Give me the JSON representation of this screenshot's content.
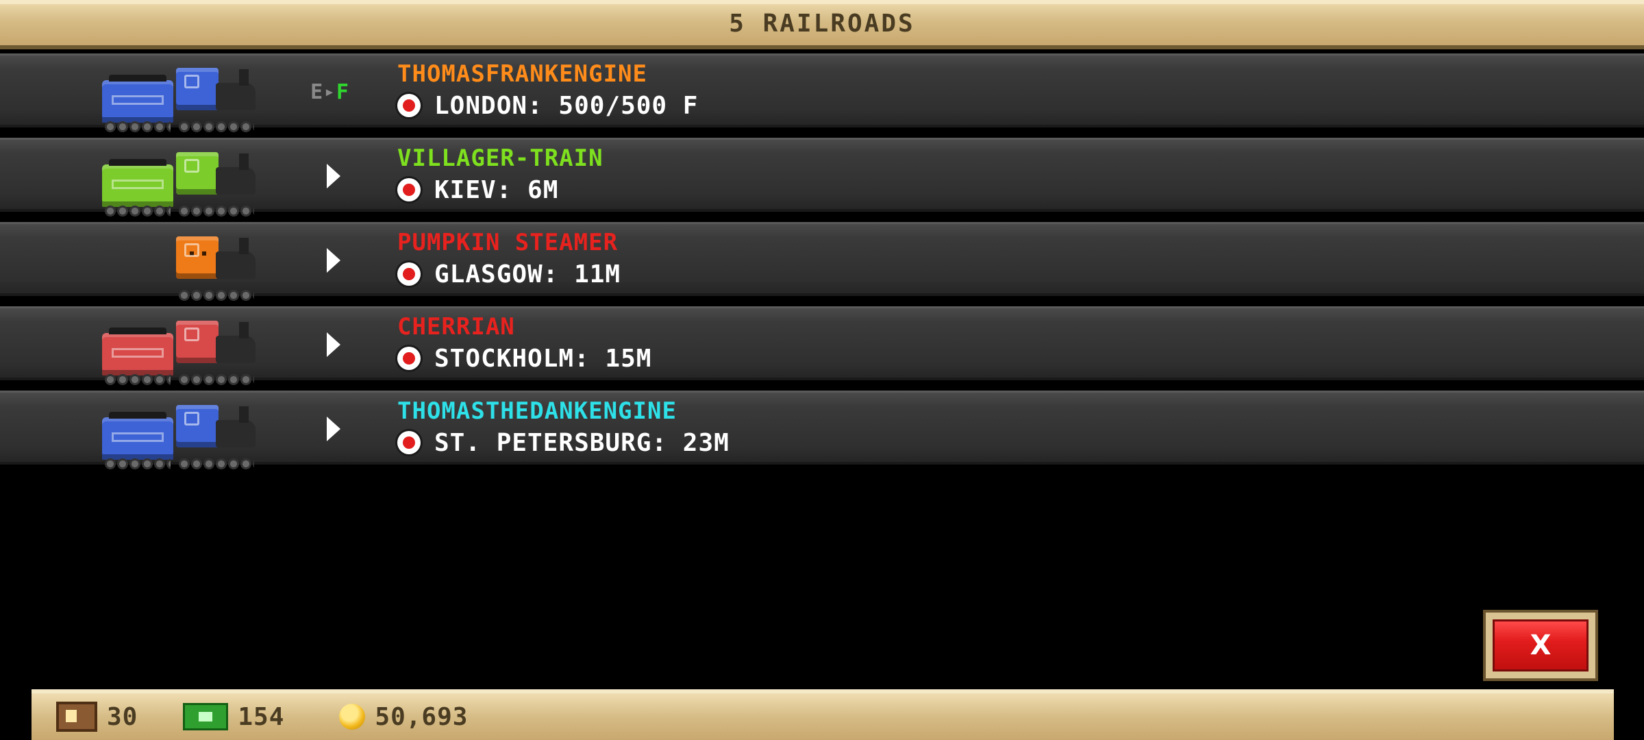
{
  "header": {
    "title": "5 RAILROADS"
  },
  "trains": [
    {
      "name": "THOMASFRANKENGINE",
      "name_color": "#ff8c1a",
      "destination": "LONDON: 500/500 F",
      "engine_color": "#3d63d6",
      "has_tender": true,
      "indicator": "fuel",
      "fuel": {
        "empty_label": "E",
        "full_label": "F"
      }
    },
    {
      "name": "VILLAGER-TRAIN",
      "name_color": "#7ee01e",
      "destination": "KIEV: 6M",
      "engine_color": "#7ccc2c",
      "has_tender": true,
      "indicator": "arrow"
    },
    {
      "name": "PUMPKIN STEAMER",
      "name_color": "#e8221e",
      "destination": "GLASGOW: 11M",
      "engine_color": "#ee7a18",
      "has_tender": false,
      "indicator": "arrow"
    },
    {
      "name": "CHERRIAN",
      "name_color": "#e8221e",
      "destination": "STOCKHOLM: 15M",
      "engine_color": "#d84a4a",
      "has_tender": true,
      "indicator": "arrow"
    },
    {
      "name": "THOMASTHEDANKENGINE",
      "name_color": "#2ee0e8",
      "destination": "ST. PETERSBURG: 23M",
      "engine_color": "#3d63d6",
      "has_tender": true,
      "indicator": "arrow"
    }
  ],
  "close_button": {
    "label": "X"
  },
  "footer": {
    "crates": "30",
    "cash": "154",
    "coins": "50,693"
  }
}
